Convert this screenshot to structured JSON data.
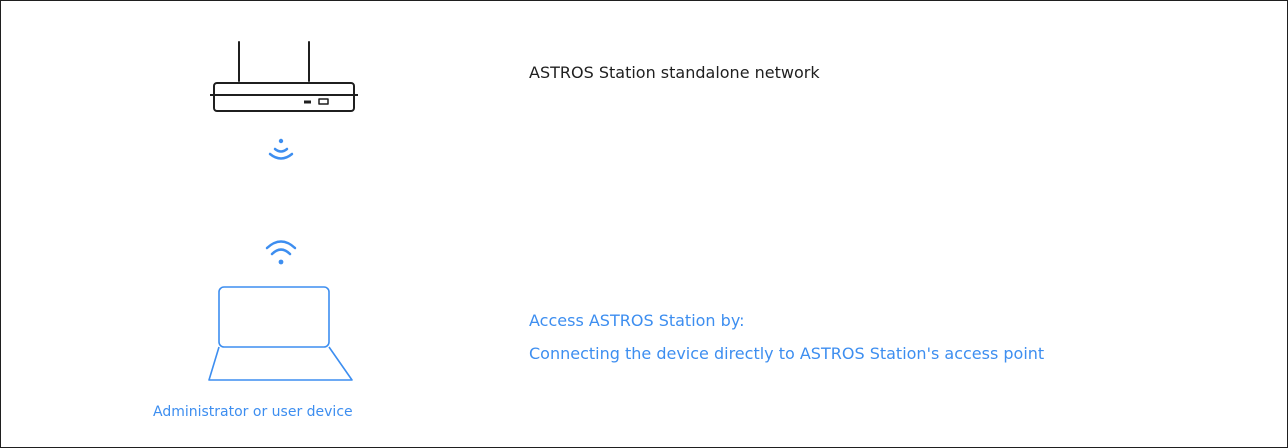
{
  "colors": {
    "border": "#1f1f1f",
    "router_stroke": "#1f1f1f",
    "accent": "#3d8ef0",
    "text_dark": "#1f1f1f"
  },
  "icons": {
    "router": "router-icon",
    "router_signal": "broadcast-waves-icon",
    "device_wifi": "wifi-icon",
    "device": "laptop-icon"
  },
  "network": {
    "title": "ASTROS Station standalone network"
  },
  "access": {
    "heading": "Access ASTROS Station by:",
    "method": "Connecting the device directly to ASTROS Station's access point"
  },
  "device": {
    "caption": "Administrator or user device"
  }
}
